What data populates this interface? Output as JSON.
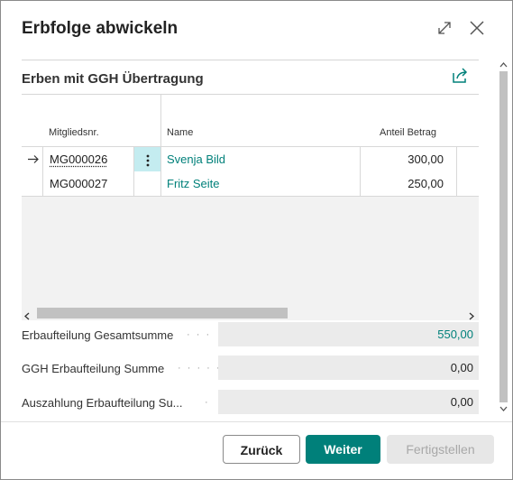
{
  "dialog": {
    "title": "Erbfolge abwickeln",
    "expand_icon": "expand-icon",
    "close_icon": "close-icon"
  },
  "section": {
    "title": "Erben mit GGH Übertragung",
    "share_icon": "share-icon"
  },
  "table": {
    "columns": [
      "Mitgliedsnr.",
      "Name",
      "Anteil Betrag"
    ],
    "rows": [
      {
        "mitgliedsnr": "MG000026",
        "name": "Svenja Bild",
        "anteil": "300,00",
        "selected": true
      },
      {
        "mitgliedsnr": "MG000027",
        "name": "Fritz Seite",
        "anteil": "250,00",
        "selected": false
      }
    ],
    "row_action_icon": "more-vertical-icon",
    "row_indicator_icon": "arrow-right-icon"
  },
  "summary": {
    "gesamt_label": "Erbaufteilung Gesamtsumme",
    "gesamt_value": "550,00",
    "ggh_label": "GGH Erbaufteilung Summe",
    "ggh_value": "0,00",
    "auszahlung_label": "Auszahlung Erbaufteilung Su...",
    "auszahlung_value": "0,00"
  },
  "buttons": {
    "back": "Zurück",
    "next": "Weiter",
    "finish": "Fertigstellen"
  },
  "colors": {
    "accent": "#00807a",
    "link": "#00807a",
    "selected_cell": "#c4ecf0",
    "disabled_bg": "#e7e7e7",
    "disabled_text": "#a8a8a8"
  }
}
